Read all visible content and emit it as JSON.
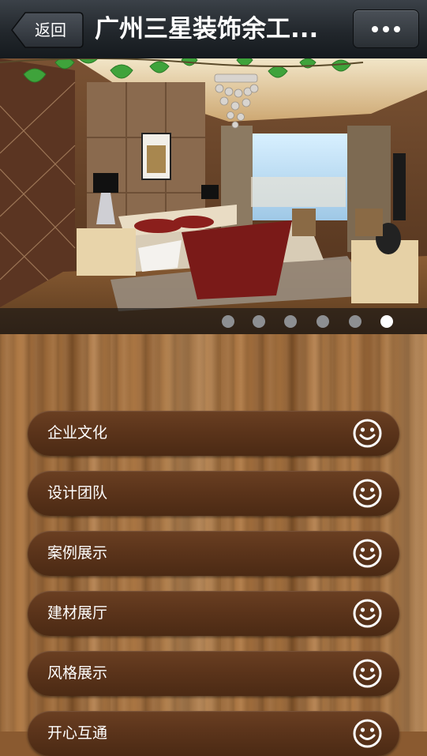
{
  "header": {
    "back_label": "返回",
    "title": "广州三星装饰余工...",
    "menu_icon": "more-dots-icon"
  },
  "banner": {
    "image": "bedroom-interior-photo",
    "pager": {
      "count": 6,
      "active_index": 5
    }
  },
  "menu": {
    "items": [
      {
        "label": "企业文化",
        "icon": "smiley-icon"
      },
      {
        "label": "设计团队",
        "icon": "smiley-icon"
      },
      {
        "label": "案例展示",
        "icon": "smiley-icon"
      },
      {
        "label": "建材展厅",
        "icon": "smiley-icon"
      },
      {
        "label": "风格展示",
        "icon": "smiley-icon"
      },
      {
        "label": "开心互通",
        "icon": "smiley-icon"
      }
    ]
  },
  "colors": {
    "header_bg": "#22272c",
    "menu_item_bg": "#5a331a",
    "pager_active": "#ffffff",
    "pager_inactive": "#8d8f92"
  }
}
